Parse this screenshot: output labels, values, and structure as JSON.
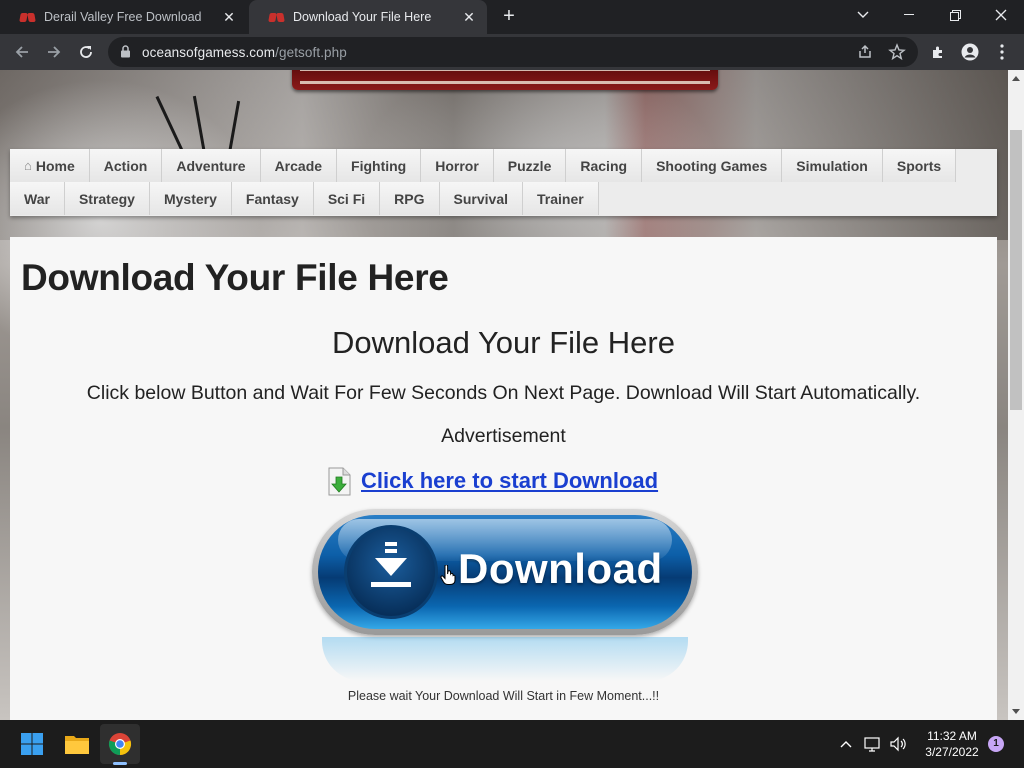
{
  "browser": {
    "tabs": [
      {
        "title": "Derail Valley Free Download",
        "active": false
      },
      {
        "title": "Download Your File Here",
        "active": true
      }
    ],
    "url": {
      "domain": "oceansofgamess.com",
      "path": "/getsoft.php"
    }
  },
  "nav": {
    "row1": [
      {
        "label": "Home",
        "icon": "home-icon"
      },
      {
        "label": "Action"
      },
      {
        "label": "Adventure"
      },
      {
        "label": "Arcade"
      },
      {
        "label": "Fighting"
      },
      {
        "label": "Horror"
      },
      {
        "label": "Puzzle"
      },
      {
        "label": "Racing"
      },
      {
        "label": "Shooting Games"
      },
      {
        "label": "Simulation"
      },
      {
        "label": "Sports"
      }
    ],
    "row2": [
      {
        "label": "War"
      },
      {
        "label": "Strategy"
      },
      {
        "label": "Mystery"
      },
      {
        "label": "Fantasy"
      },
      {
        "label": "Sci Fi"
      },
      {
        "label": "RPG"
      },
      {
        "label": "Survival"
      },
      {
        "label": "Trainer"
      }
    ]
  },
  "content": {
    "page_title": "Download Your File Here",
    "subtitle": "Download Your File Here",
    "instructions": "Click below Button and Wait For Few Seconds On Next Page. Download Will Start Automatically.",
    "advertisement": "Advertisement",
    "download_link": "Click here to start Download",
    "download_button": "Download",
    "wait_text": "Please wait Your Download Will Start in Few Moment...!!"
  },
  "taskbar": {
    "time": "11:32 AM",
    "date": "3/27/2022",
    "notifications": "1"
  },
  "colors": {
    "link": "#1a3fd0",
    "button_blue": "#0d5fa8",
    "chrome_dark": "#202124"
  }
}
